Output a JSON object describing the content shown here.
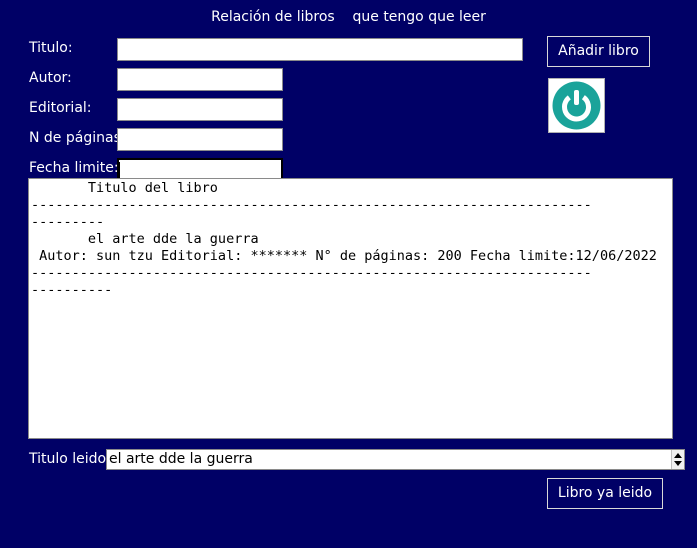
{
  "window": {
    "title": "Relación de libros    que tengo que leer"
  },
  "form": {
    "titulo_label": "Titulo:",
    "autor_label": "Autor:",
    "editorial_label": "Editorial:",
    "paginas_label": "N de páginas:",
    "fecha_label": "Fecha limite:",
    "titulo_value": "",
    "autor_value": "",
    "editorial_value": "",
    "paginas_value": "",
    "fecha_value": ""
  },
  "buttons": {
    "add_label": "Añadir libro",
    "read_label": "Libro ya leido",
    "power_icon": "power-icon",
    "power_color": "#1aa39a"
  },
  "list": {
    "lines": [
      "       Titulo del libro",
      "---------------------------------------------------------------------",
      "---------",
      "       el arte dde la guerra",
      " Autor: sun tzu Editorial: ******* N° de páginas: 200 Fecha limite:12/06/2022",
      "---------------------------------------------------------------------",
      "----------"
    ]
  },
  "read": {
    "label": "Titulo leido:",
    "value": "el arte dde la guerra"
  }
}
